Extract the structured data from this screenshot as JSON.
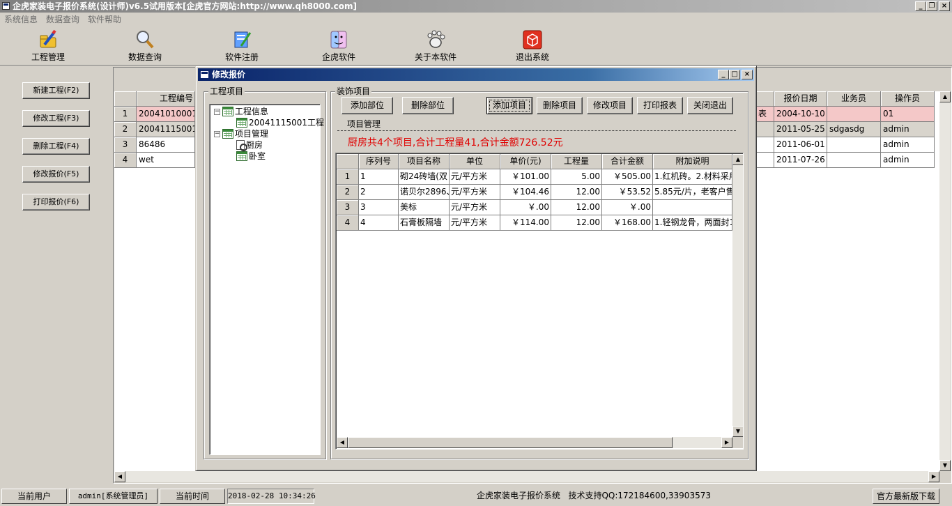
{
  "window": {
    "title": "企虎家装电子报价系统(设计师)v6.5试用版本[企虎官方网站:http://www.qh8000.com]"
  },
  "menu": [
    "系统信息",
    "数据查询",
    "软件帮助"
  ],
  "toolbar": {
    "items": [
      {
        "label": "工程管理",
        "icon": "folder-pen-icon"
      },
      {
        "label": "数据查询",
        "icon": "magnifier-icon"
      },
      {
        "label": "软件注册",
        "icon": "register-icon"
      },
      {
        "label": "企虎软件",
        "icon": "finder-icon"
      },
      {
        "label": "关于本软件",
        "icon": "paw-icon"
      },
      {
        "label": "退出系统",
        "icon": "exit-cube-icon"
      }
    ]
  },
  "left_buttons": [
    "新建工程(F2)",
    "修改工程(F3)",
    "删除工程(F4)",
    "修改报价(F5)",
    "打印报价(F6)"
  ],
  "bg_grid": {
    "col_project": "工程编号",
    "col_date": "报价日期",
    "col_sales": "业务员",
    "col_operator": "操作员",
    "rows": [
      {
        "num": "1",
        "project": "20041010001",
        "mid": "表",
        "date": "2004-10-10",
        "sales": "",
        "operator": "01"
      },
      {
        "num": "2",
        "project": "20041115001",
        "mid": "",
        "date": "2011-05-25",
        "sales": "sdgasdg",
        "operator": "admin"
      },
      {
        "num": "3",
        "project": "86486",
        "mid": "",
        "date": "2011-06-01",
        "sales": "",
        "operator": "admin"
      },
      {
        "num": "4",
        "project": "wet",
        "mid": "",
        "date": "2011-07-26",
        "sales": "",
        "operator": "admin"
      }
    ]
  },
  "dialog": {
    "title": "修改报价",
    "left_group": "工程项目",
    "right_group": "装饰项目",
    "tree": {
      "root1": "工程信息",
      "child1": "20041115001工程",
      "root2": "项目管理",
      "child2": "厨房",
      "child3": "卧室"
    },
    "buttons": {
      "add_section": "添加部位",
      "delete_section": "删除部位",
      "add_item": "添加项目",
      "delete_item": "删除项目",
      "modify_item": "修改项目",
      "print_report": "打印报表",
      "close_exit": "关闭退出"
    },
    "section_label": "项目管理",
    "summary": "厨房共4个项目,合计工程量41,合计金额726.52元",
    "grid": {
      "headers": [
        "序列号",
        "项目名称",
        "单位",
        "单价(元)",
        "工程量",
        "合计金额",
        "附加说明"
      ],
      "rows": [
        {
          "num": "1",
          "seq": "1",
          "name": "砌24砖墙(双",
          "unit": "元/平方米",
          "price": "￥101.00",
          "qty": "5.00",
          "total": "￥505.00",
          "note": "1.红机砖。2.材料采用"
        },
        {
          "num": "2",
          "seq": "2",
          "name": "诺贝尔2896、",
          "unit": "元/平方米",
          "price": "￥104.46",
          "qty": "12.00",
          "total": "￥53.52",
          "note": "5.85元/片，老客户售"
        },
        {
          "num": "3",
          "seq": "3",
          "name": "美标",
          "unit": "元/平方米",
          "price": "￥.00",
          "qty": "12.00",
          "total": "￥.00",
          "note": ""
        },
        {
          "num": "4",
          "seq": "4",
          "name": "石膏板隔墙",
          "unit": "元/平方米",
          "price": "￥114.00",
          "qty": "12.00",
          "total": "￥168.00",
          "note": "1.轻钢龙骨，两面封1"
        }
      ]
    }
  },
  "statusbar": {
    "user_label": "当前用户",
    "user_value": "admin[系统管理员]",
    "time_label": "当前时间",
    "time_value": "2018-02-28 10:34:26",
    "info": "企虎家装电子报价系统   技术支持QQ:172184600,33903573",
    "download": "官方最新版下载"
  },
  "colors": {
    "dialog_title_start": "#0a246a",
    "summary_text": "#e00000",
    "row_highlight": "#f4c8c8"
  }
}
